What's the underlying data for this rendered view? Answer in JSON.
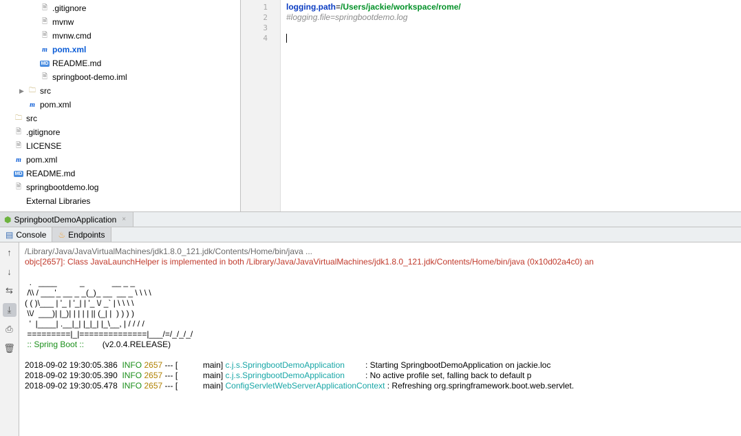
{
  "tree": {
    "items": [
      {
        "indent": 3,
        "arrow": "",
        "iconType": "file",
        "label": ".gitignore"
      },
      {
        "indent": 3,
        "arrow": "",
        "iconType": "file",
        "label": "mvnw"
      },
      {
        "indent": 3,
        "arrow": "",
        "iconType": "file",
        "label": "mvnw.cmd"
      },
      {
        "indent": 3,
        "arrow": "",
        "iconType": "maven",
        "label": "pom.xml",
        "blue": true
      },
      {
        "indent": 3,
        "arrow": "",
        "iconType": "md",
        "label": "README.md"
      },
      {
        "indent": 3,
        "arrow": "",
        "iconType": "file",
        "label": "springboot-demo.iml"
      },
      {
        "indent": 1,
        "arrow": "▶",
        "iconType": "folder",
        "label": "src"
      },
      {
        "indent": 1,
        "arrow": "",
        "iconType": "maven",
        "label": "pom.xml"
      },
      {
        "indent": 0,
        "arrow": "",
        "iconType": "folder",
        "label": "src"
      },
      {
        "indent": 0,
        "arrow": "",
        "iconType": "file",
        "label": ".gitignore"
      },
      {
        "indent": 0,
        "arrow": "",
        "iconType": "file",
        "label": "LICENSE"
      },
      {
        "indent": 0,
        "arrow": "",
        "iconType": "maven",
        "label": "pom.xml"
      },
      {
        "indent": 0,
        "arrow": "",
        "iconType": "md",
        "label": "README.md"
      },
      {
        "indent": 0,
        "arrow": "",
        "iconType": "file",
        "label": "springbootdemo.log"
      },
      {
        "indent": 0,
        "arrow": "",
        "iconType": "none",
        "label": "External Libraries"
      }
    ]
  },
  "editor": {
    "line1_key": "logging.path",
    "line1_sep": "=",
    "line1_val": "/Users/jackie/workspace/rome/",
    "line2": "#logging.file=springbootdemo.log",
    "gutter": [
      "1",
      "2",
      "3",
      "4"
    ]
  },
  "runTab": {
    "label": "SpringbootDemoApplication"
  },
  "consoleTabs": {
    "console": "Console",
    "endpoints": "Endpoints"
  },
  "console": {
    "header": "/Library/Java/JavaVirtualMachines/jdk1.8.0_121.jdk/Contents/Home/bin/java ...",
    "objc": "objc[2657]: Class JavaLaunchHelper is implemented in both /Library/Java/JavaVirtualMachines/jdk1.8.0_121.jdk/Contents/Home/bin/java (0x10d02a4c0) an",
    "banner": "  .   ____          _            __ _ _\n /\\\\ / ___'_ __ _ _(_)_ __  __ _ \\ \\ \\ \\\n( ( )\\___ | '_ | '_| | '_ \\/ _` | \\ \\ \\ \\\n \\\\/  ___)| |_)| | | | | || (_| |  ) ) ) )\n  '  |____| .__|_| |_|_| |_\\__, | / / / /\n =========|_|==============|___/=/_/_/_/",
    "bannerTag": " :: Spring Boot ::        ",
    "bannerVer": "(v2.0.4.RELEASE)",
    "lines": [
      {
        "ts": "2018-09-02 19:30:05.386",
        "level": "INFO",
        "pid": "2657",
        "dash": "--- [",
        "thread": "           main]",
        "logger": "c.j.s.SpringbootDemoApplication",
        "msg": "         : Starting SpringbootDemoApplication on jackie.loc"
      },
      {
        "ts": "2018-09-02 19:30:05.390",
        "level": "INFO",
        "pid": "2657",
        "dash": "--- [",
        "thread": "           main]",
        "logger": "c.j.s.SpringbootDemoApplication",
        "msg": "         : No active profile set, falling back to default p"
      },
      {
        "ts": "2018-09-02 19:30:05.478",
        "level": "INFO",
        "pid": "2657",
        "dash": "--- [",
        "thread": "           main]",
        "logger": "ConfigServletWebServerApplicationContext",
        "msg": " : Refreshing org.springframework.boot.web.servlet."
      }
    ]
  },
  "toolIcons": {
    "up": "↑",
    "down": "↓",
    "wrap": "⇆",
    "scroll": "⤓",
    "print": "⎙",
    "trash": "🗑"
  }
}
